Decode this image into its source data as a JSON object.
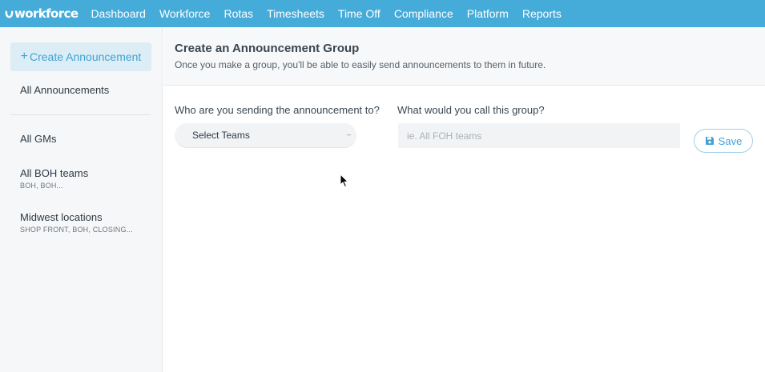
{
  "nav": {
    "logo": "workforce",
    "items": [
      "Dashboard",
      "Workforce",
      "Rotas",
      "Timesheets",
      "Time Off",
      "Compliance",
      "Platform",
      "Reports"
    ]
  },
  "sidebar": {
    "create_button": "Create Announcement",
    "all_announcements": "All Announcements",
    "groups": [
      {
        "name": "All GMs",
        "teams": ""
      },
      {
        "name": "All BOH teams",
        "teams": "BOH, BOH..."
      },
      {
        "name": "Midwest locations",
        "teams": "SHOP FRONT, BOH, CLOSING..."
      }
    ]
  },
  "main": {
    "title": "Create an Announcement Group",
    "subtitle": "Once you make a group, you'll be able to easily send announcements to them in future.",
    "recipients_label": "Who are you sending the announcement to?",
    "select_teams_value": "Select Teams",
    "group_name_label": "What would you call this group?",
    "group_name_placeholder": "ie. All FOH teams",
    "group_name_value": "",
    "save_label": "Save"
  },
  "colors": {
    "brand": "#45abd9",
    "accent": "#3fa3d4",
    "sidebar_bg": "#f6f7f8"
  },
  "icons": {
    "logo": "workforce-logo-icon",
    "plus": "plus-icon",
    "caret": "caret-down-icon",
    "save": "floppy-disk-icon",
    "cursor": "mouse-pointer-icon"
  }
}
